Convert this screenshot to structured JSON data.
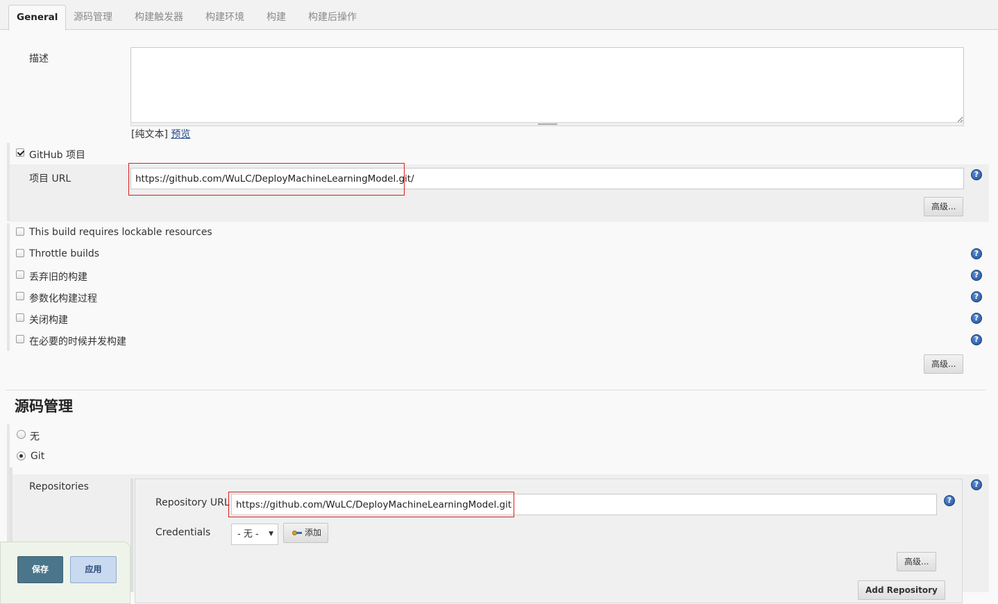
{
  "tabs": [
    {
      "label": "General",
      "active": true
    },
    {
      "label": "源码管理"
    },
    {
      "label": "构建触发器"
    },
    {
      "label": "构建环境"
    },
    {
      "label": "构建"
    },
    {
      "label": "构建后操作"
    }
  ],
  "general": {
    "description_label": "描述",
    "description_value": "",
    "plain_text": "[纯文本]",
    "preview_link": "预览",
    "github_project": {
      "label": "GitHub 项目",
      "checked": true
    },
    "project_url_label": "项目 URL",
    "project_url_value": "https://github.com/WuLC/DeployMachineLearningModel.git/",
    "advanced_label": "高级...",
    "options": [
      {
        "label": "This build requires lockable resources",
        "checked": false
      },
      {
        "label": "Throttle builds",
        "checked": false
      },
      {
        "label": "丢弃旧的构建",
        "checked": false
      },
      {
        "label": "参数化构建过程",
        "checked": false
      },
      {
        "label": "关闭构建",
        "checked": false
      },
      {
        "label": "在必要的时候并发构建",
        "checked": false
      }
    ],
    "advanced2_label": "高级..."
  },
  "scm": {
    "title": "源码管理",
    "none_label": "无",
    "git_label": "Git",
    "selected": "Git",
    "repositories_label": "Repositories",
    "repository_url_label": "Repository URL",
    "repository_url_value": "https://github.com/WuLC/DeployMachineLearningModel.git",
    "credentials_label": "Credentials",
    "credentials_selected": "- 无 -",
    "add_label": "添加",
    "advanced_label": "高级...",
    "add_repository_label": "Add Repository"
  },
  "footer": {
    "save_label": "保存",
    "apply_label": "应用"
  },
  "icons": {
    "help": "?",
    "dropdown": "▼"
  },
  "colors": {
    "highlight_box": "#d81c1c",
    "save_button": "#4b758b",
    "apply_button": "#c9d9ef",
    "help_icon": "#2a5caa"
  }
}
